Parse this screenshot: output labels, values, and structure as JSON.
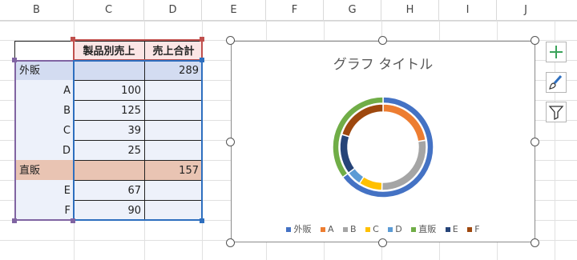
{
  "columns": [
    "B",
    "C",
    "D",
    "E",
    "F",
    "G",
    "H",
    "I",
    "J"
  ],
  "table": {
    "headers": [
      "製品別売上",
      "売上合計"
    ],
    "rows": [
      {
        "label": "外販",
        "sales": "",
        "total": "289"
      },
      {
        "label": "A",
        "sales": "100",
        "total": ""
      },
      {
        "label": "B",
        "sales": "125",
        "total": ""
      },
      {
        "label": "C",
        "sales": "39",
        "total": ""
      },
      {
        "label": "D",
        "sales": "25",
        "total": ""
      },
      {
        "label": "直販",
        "sales": "",
        "total": "157"
      },
      {
        "label": "E",
        "sales": "67",
        "total": ""
      },
      {
        "label": "F",
        "sales": "90",
        "total": ""
      }
    ]
  },
  "chart": {
    "title": "グラフ タイトル",
    "legend": [
      {
        "name": "外販",
        "color": "#4472c4"
      },
      {
        "name": "A",
        "color": "#ed7d31"
      },
      {
        "name": "B",
        "color": "#a5a5a5"
      },
      {
        "name": "C",
        "color": "#ffc000"
      },
      {
        "name": "D",
        "color": "#5b9bd5"
      },
      {
        "name": "直販",
        "color": "#70ad47"
      },
      {
        "name": "E",
        "color": "#264478"
      },
      {
        "name": "F",
        "color": "#9e480e"
      }
    ]
  },
  "chart_data": {
    "type": "pie",
    "title": "グラフ タイトル",
    "legend_position": "bottom",
    "series": [
      {
        "name": "売上合計",
        "ring": "outer",
        "values": [
          {
            "label": "外販",
            "value": 289,
            "color": "#4472c4"
          },
          {
            "label": "直販",
            "value": 157,
            "color": "#70ad47"
          }
        ]
      },
      {
        "name": "製品別売上",
        "ring": "inner",
        "values": [
          {
            "label": "A",
            "value": 100,
            "color": "#ed7d31"
          },
          {
            "label": "B",
            "value": 125,
            "color": "#a5a5a5"
          },
          {
            "label": "C",
            "value": 39,
            "color": "#ffc000"
          },
          {
            "label": "D",
            "value": 25,
            "color": "#5b9bd5"
          },
          {
            "label": "E",
            "value": 67,
            "color": "#264478"
          },
          {
            "label": "F",
            "value": 90,
            "color": "#9e480e"
          }
        ]
      }
    ]
  },
  "tools": [
    {
      "name": "chart-elements-icon"
    },
    {
      "name": "chart-styles-icon"
    },
    {
      "name": "chart-filters-icon"
    }
  ]
}
